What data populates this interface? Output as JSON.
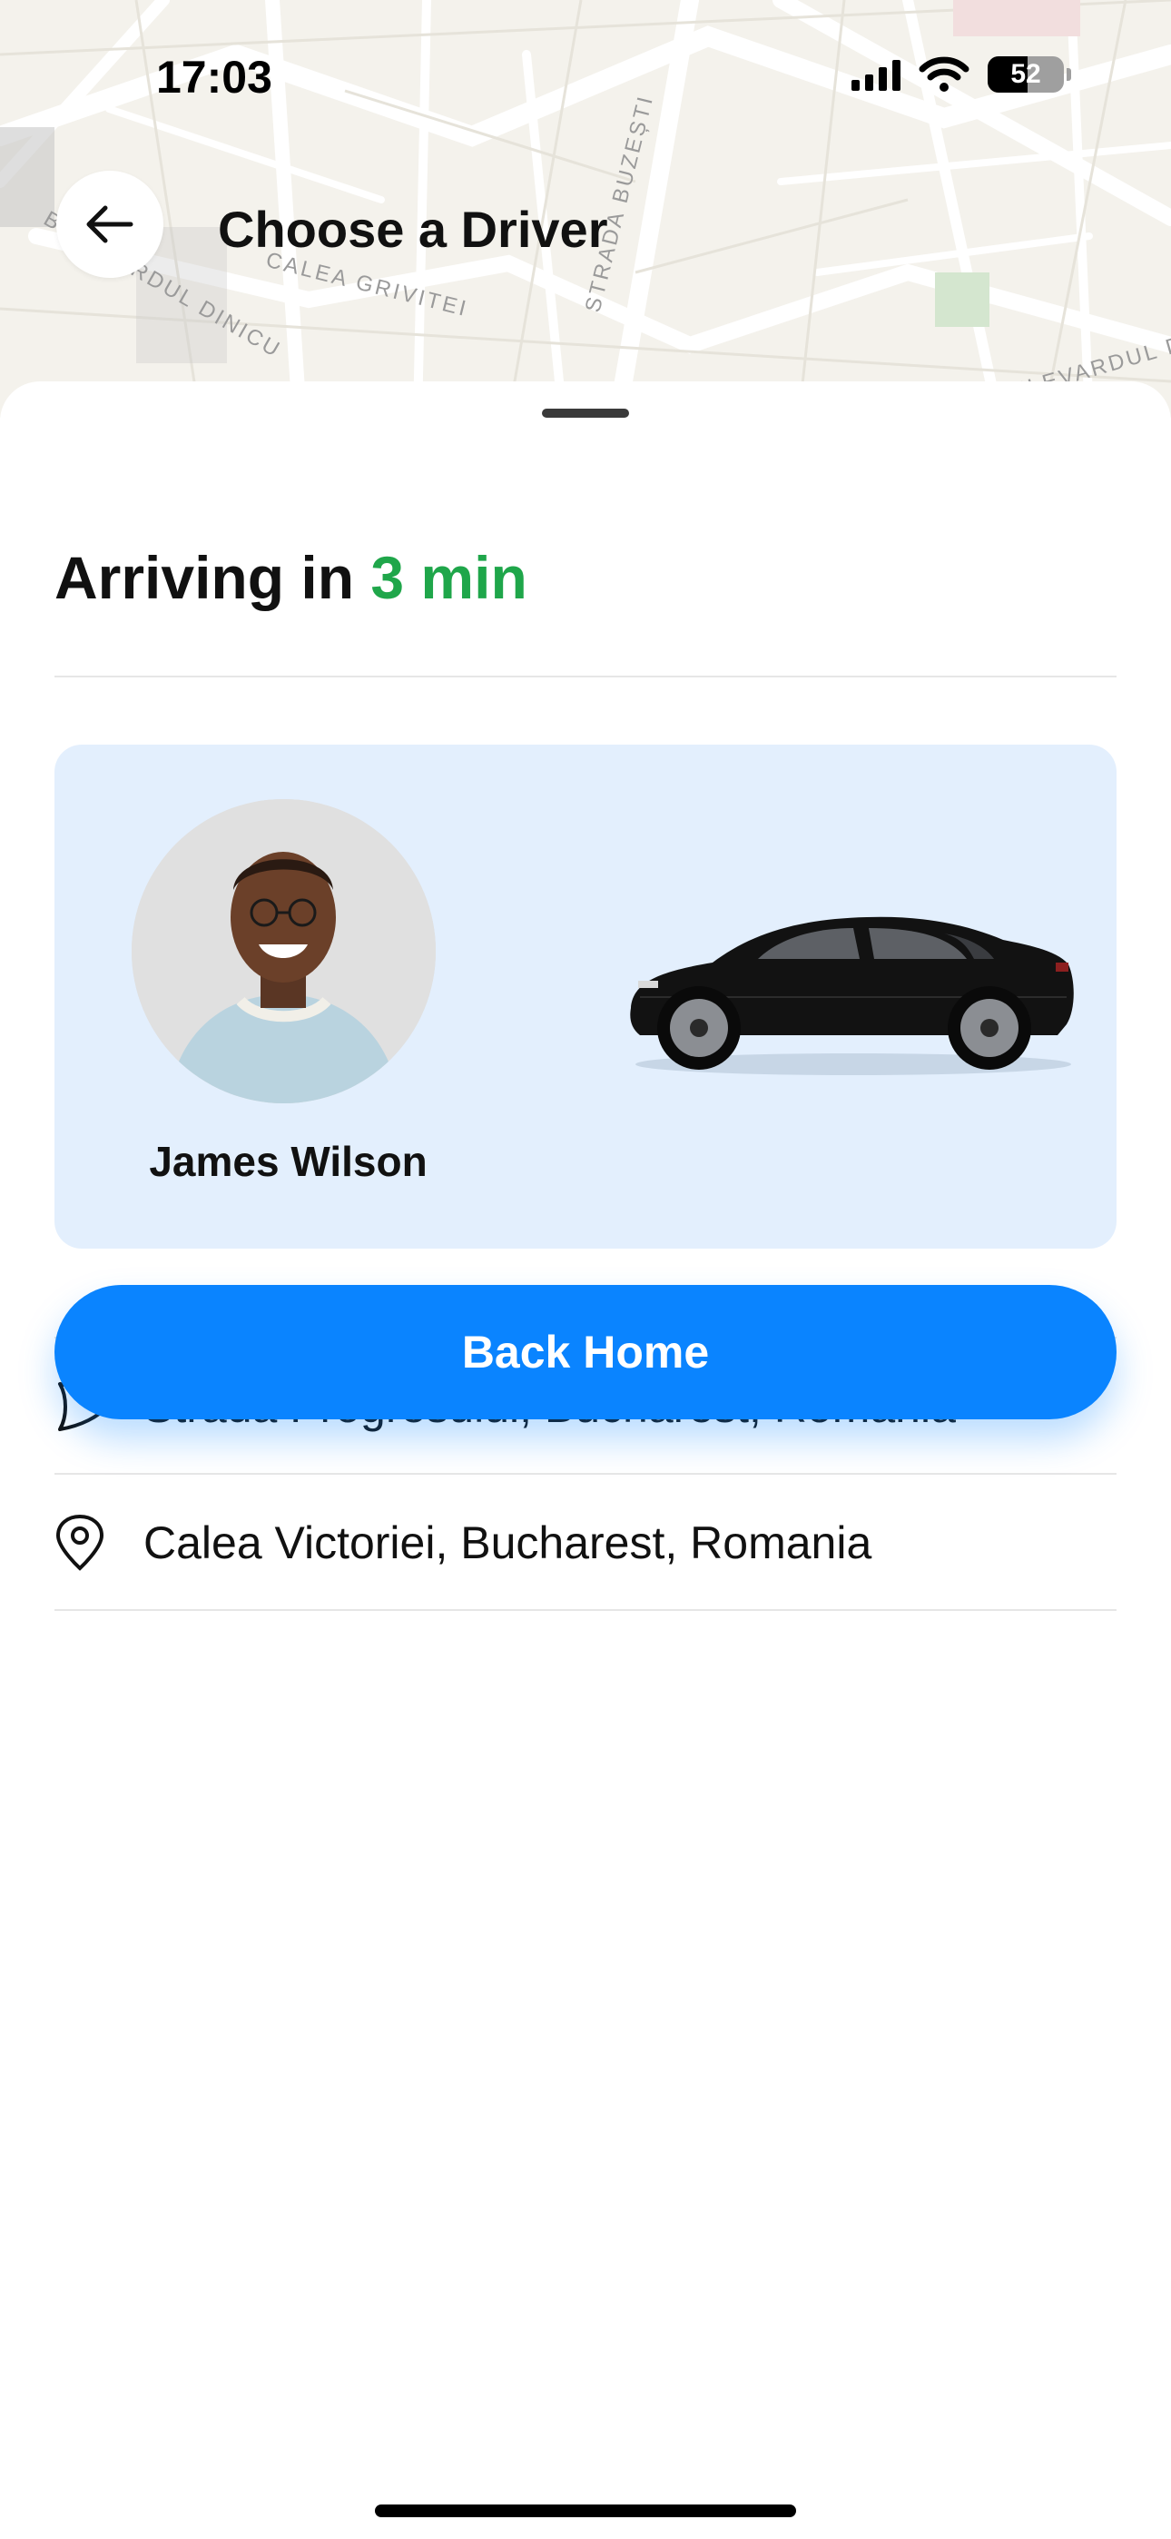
{
  "status_bar": {
    "time": "17:03",
    "battery_level": "52",
    "icons": [
      "cellular-signal-icon",
      "wifi-icon",
      "battery-icon"
    ]
  },
  "map": {
    "street_labels": [
      "CALEA GRIVITEI",
      "STRADA BUZEȘTI",
      "BULEVARDUL DINICU",
      "BULEVARDUL DACIA"
    ]
  },
  "header": {
    "title": "Choose a Driver",
    "back_icon": "arrow-left-icon"
  },
  "trip": {
    "arriving_prefix": "Arriving in",
    "eta": "3 min",
    "eta_color": "#1fa64a"
  },
  "driver": {
    "name": "James Wilson",
    "vehicle_color": "black"
  },
  "route": {
    "pickup": "Strada Progresului, Bucharest, Romania",
    "pickup_icon": "navigation-arrow-icon",
    "destination": "Calea Victoriei, Bucharest, Romania",
    "destination_icon": "map-pin-icon"
  },
  "actions": {
    "back_home_label": "Back Home",
    "accent_color": "#0a84ff"
  }
}
